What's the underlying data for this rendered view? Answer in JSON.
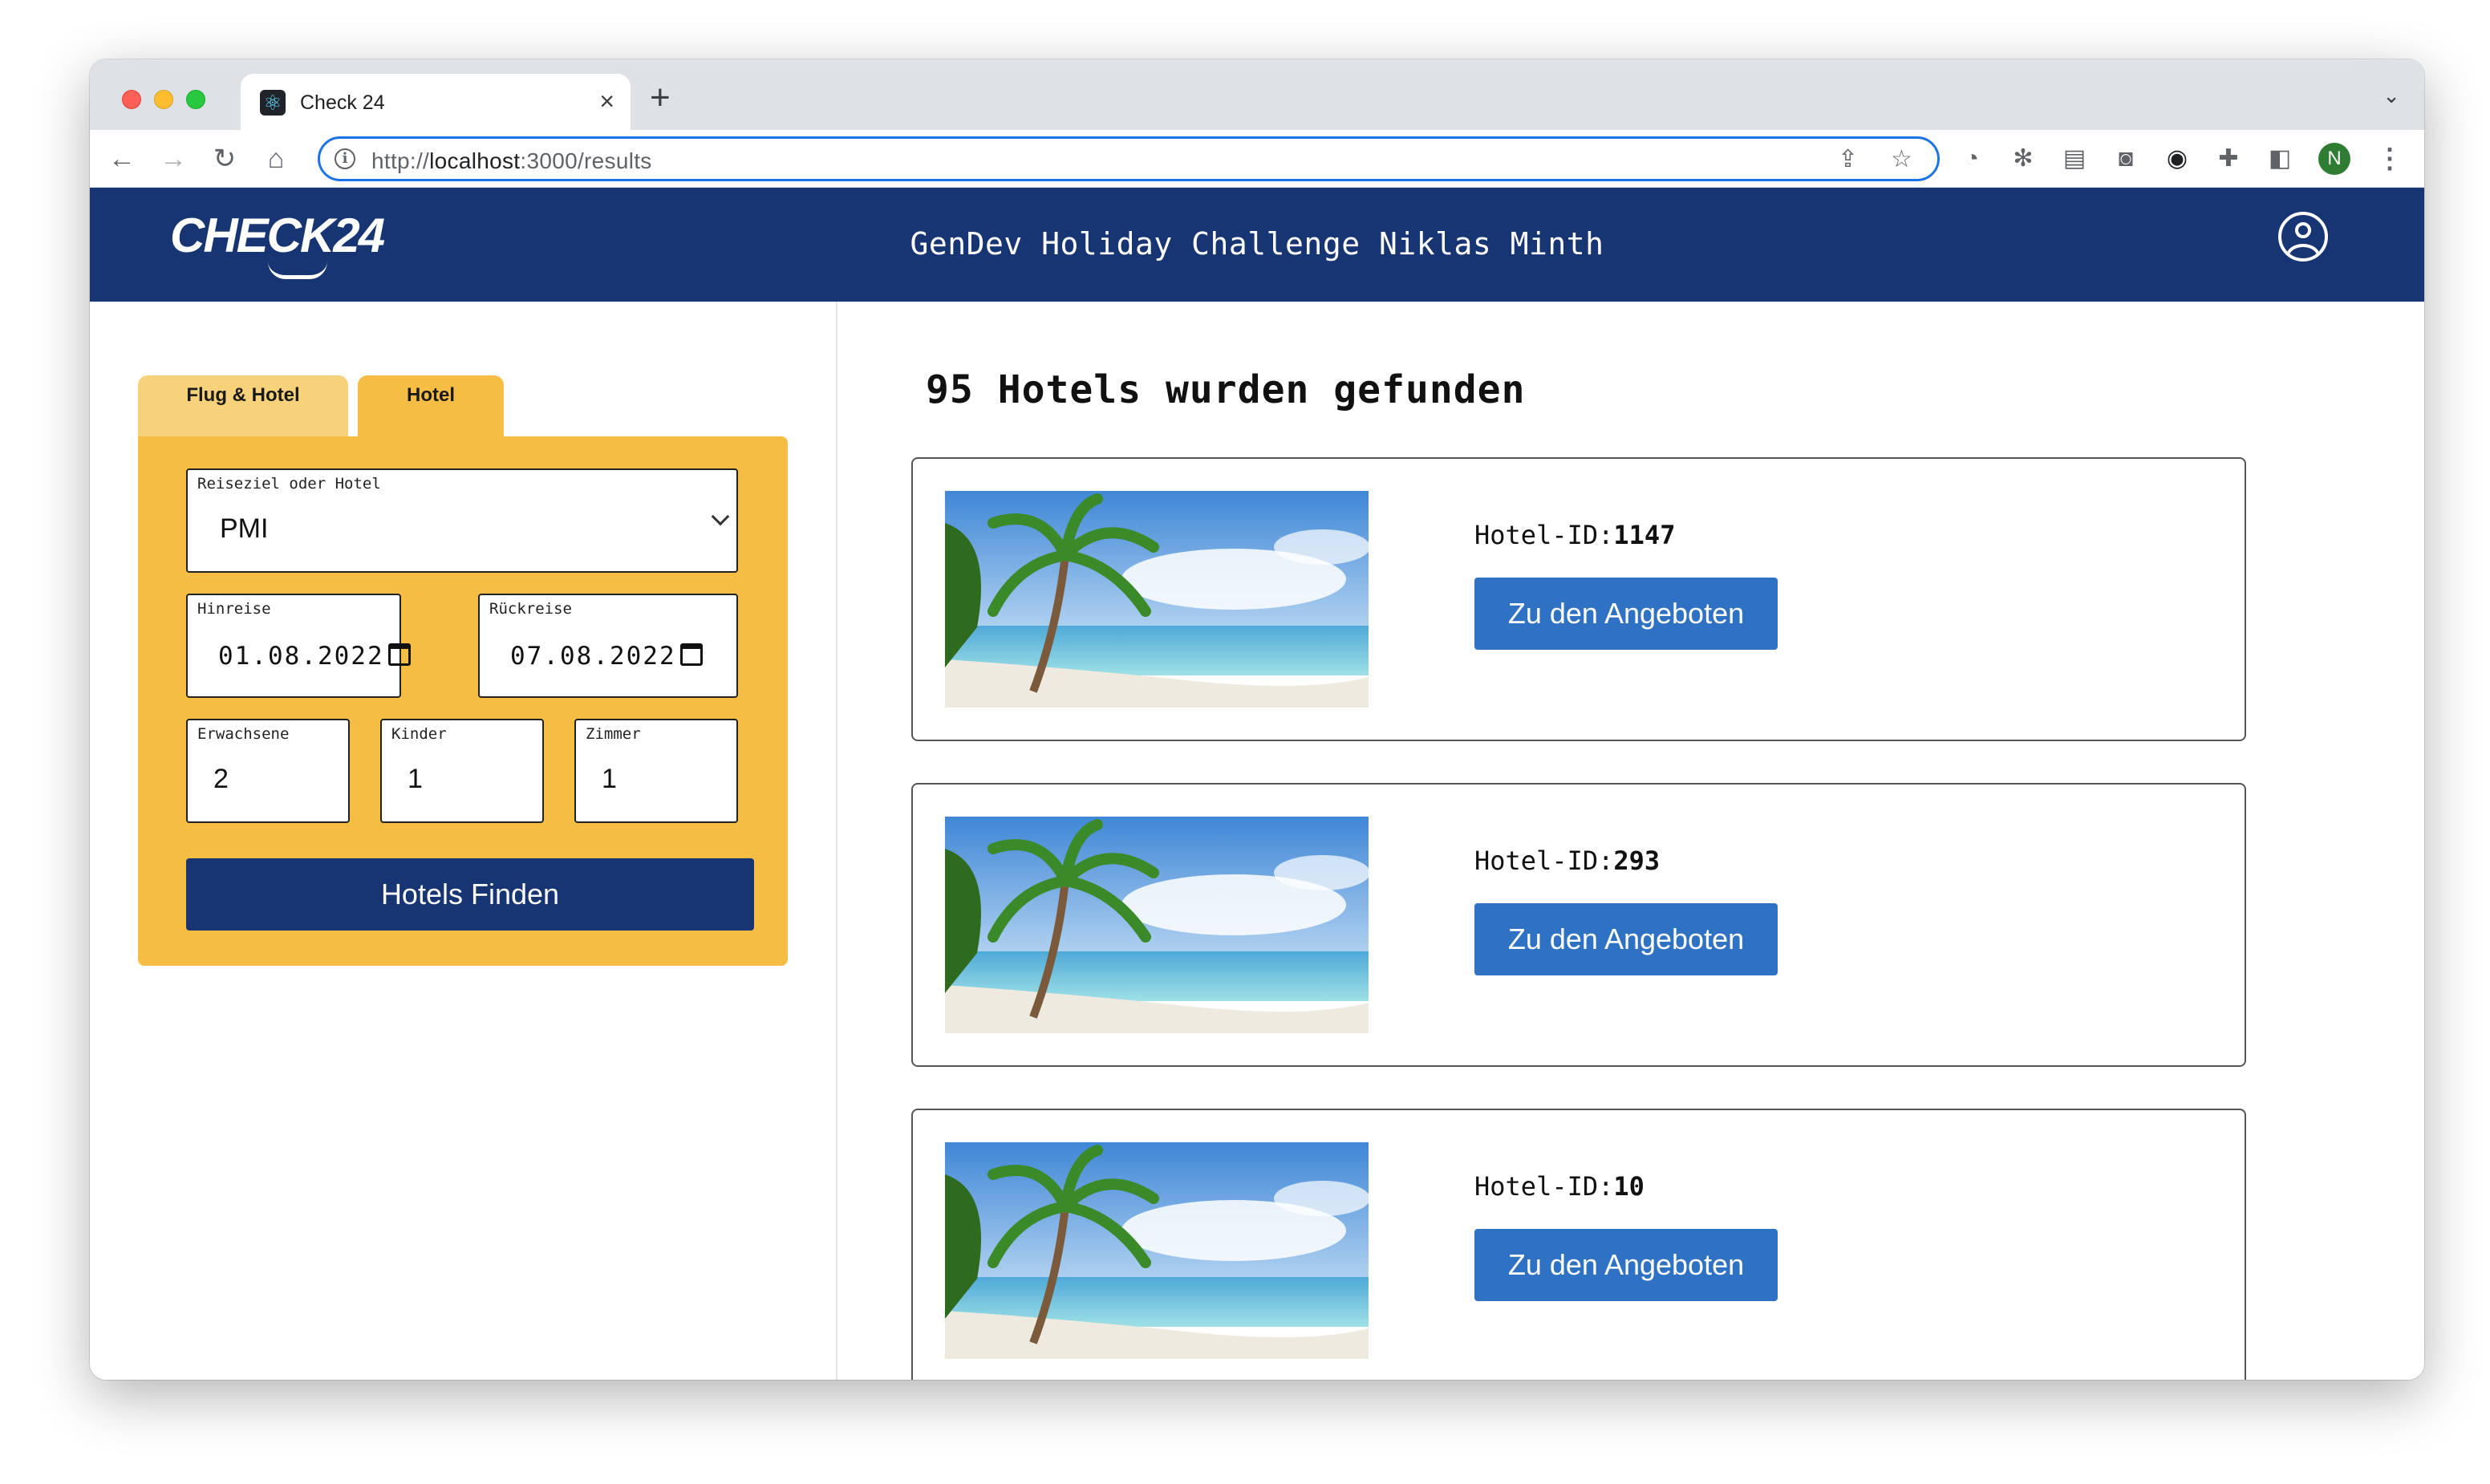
{
  "browser": {
    "tab_title": "Check 24",
    "tab_close": "×",
    "new_tab": "+",
    "url_prefix": "http://",
    "url_host": "localhost",
    "url_path": ":3000/results",
    "profile_initial": "N"
  },
  "header": {
    "logo_text": "CHECK24",
    "title": "GenDev Holiday Challenge Niklas Minth",
    "background_color": "#173573"
  },
  "search_form": {
    "tabs": [
      "Flug & Hotel",
      "Hotel"
    ],
    "active_tab": "Hotel",
    "destination": {
      "label": "Reiseziel oder Hotel",
      "value": "PMI"
    },
    "departure": {
      "label": "Hinreise",
      "value": "01.08.2022"
    },
    "return": {
      "label": "Rückreise",
      "value": "07.08.2022"
    },
    "adults": {
      "label": "Erwachsene",
      "value": "2"
    },
    "children": {
      "label": "Kinder",
      "value": "1"
    },
    "rooms": {
      "label": "Zimmer",
      "value": "1"
    },
    "submit_label": "Hotels Finden",
    "accent_color": "#f5bd43"
  },
  "results": {
    "title": "95 Hotels wurden gefunden",
    "hotels": [
      {
        "id_label": "Hotel-ID:",
        "id": "1147",
        "button_label": "Zu den Angeboten"
      },
      {
        "id_label": "Hotel-ID:",
        "id": "293",
        "button_label": "Zu den Angeboten"
      },
      {
        "id_label": "Hotel-ID:",
        "id": "10",
        "button_label": "Zu den Angeboten"
      }
    ],
    "button_color": "#2f72c4"
  }
}
